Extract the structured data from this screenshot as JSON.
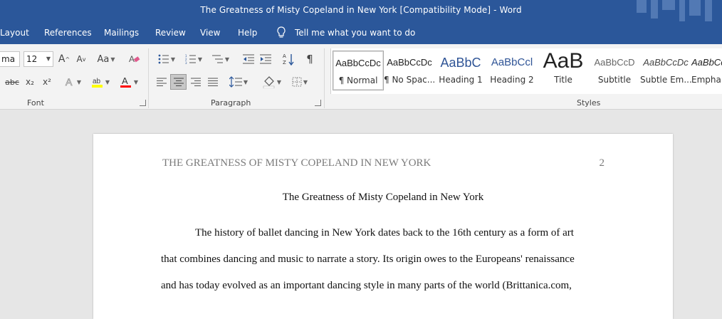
{
  "window": {
    "title": "The Greatness of Misty Copeland in New York [Compatibility Mode]  -  Word"
  },
  "tabs": [
    "Layout",
    "References",
    "Mailings",
    "Review",
    "View",
    "Help"
  ],
  "tell_me": "Tell me what you want to do",
  "font": {
    "name": "ma",
    "size": "12",
    "grow": "A",
    "shrink": "A",
    "case": "Aa",
    "strikethrough": "abc",
    "subscript": "x₂",
    "superscript": "x²"
  },
  "groups": {
    "font": "Font",
    "paragraph": "Paragraph",
    "styles": "Styles"
  },
  "styles": [
    {
      "preview": "AaBbCcDc",
      "name": "¶ Normal"
    },
    {
      "preview": "AaBbCcDc",
      "name": "¶ No Spac..."
    },
    {
      "preview": "AaBbC",
      "name": "Heading 1"
    },
    {
      "preview": "AaBbCcl",
      "name": "Heading 2"
    },
    {
      "preview": "AaB",
      "name": "Title"
    },
    {
      "preview": "AaBbCcD",
      "name": "Subtitle"
    },
    {
      "preview": "AaBbCcDc",
      "name": "Subtle Em..."
    },
    {
      "preview": "AaBbCc",
      "name": "Empha"
    }
  ],
  "colors": {
    "accent": "#2b579a",
    "highlight": "#ffff00",
    "font_color": "#ff0000"
  },
  "document": {
    "running_head": "THE GREATNESS OF MISTY COPELAND IN NEW YORK",
    "page_number": "2",
    "title": "The Greatness of Misty Copeland in New York",
    "lines": [
      "The history of ballet dancing in New York dates back to the 16th century as a form of art",
      "that combines dancing and music to narrate a story. Its origin owes to the Europeans' renaissance",
      "and has today evolved as an important dancing style in many parts of the world (Brittanica.com,"
    ]
  }
}
